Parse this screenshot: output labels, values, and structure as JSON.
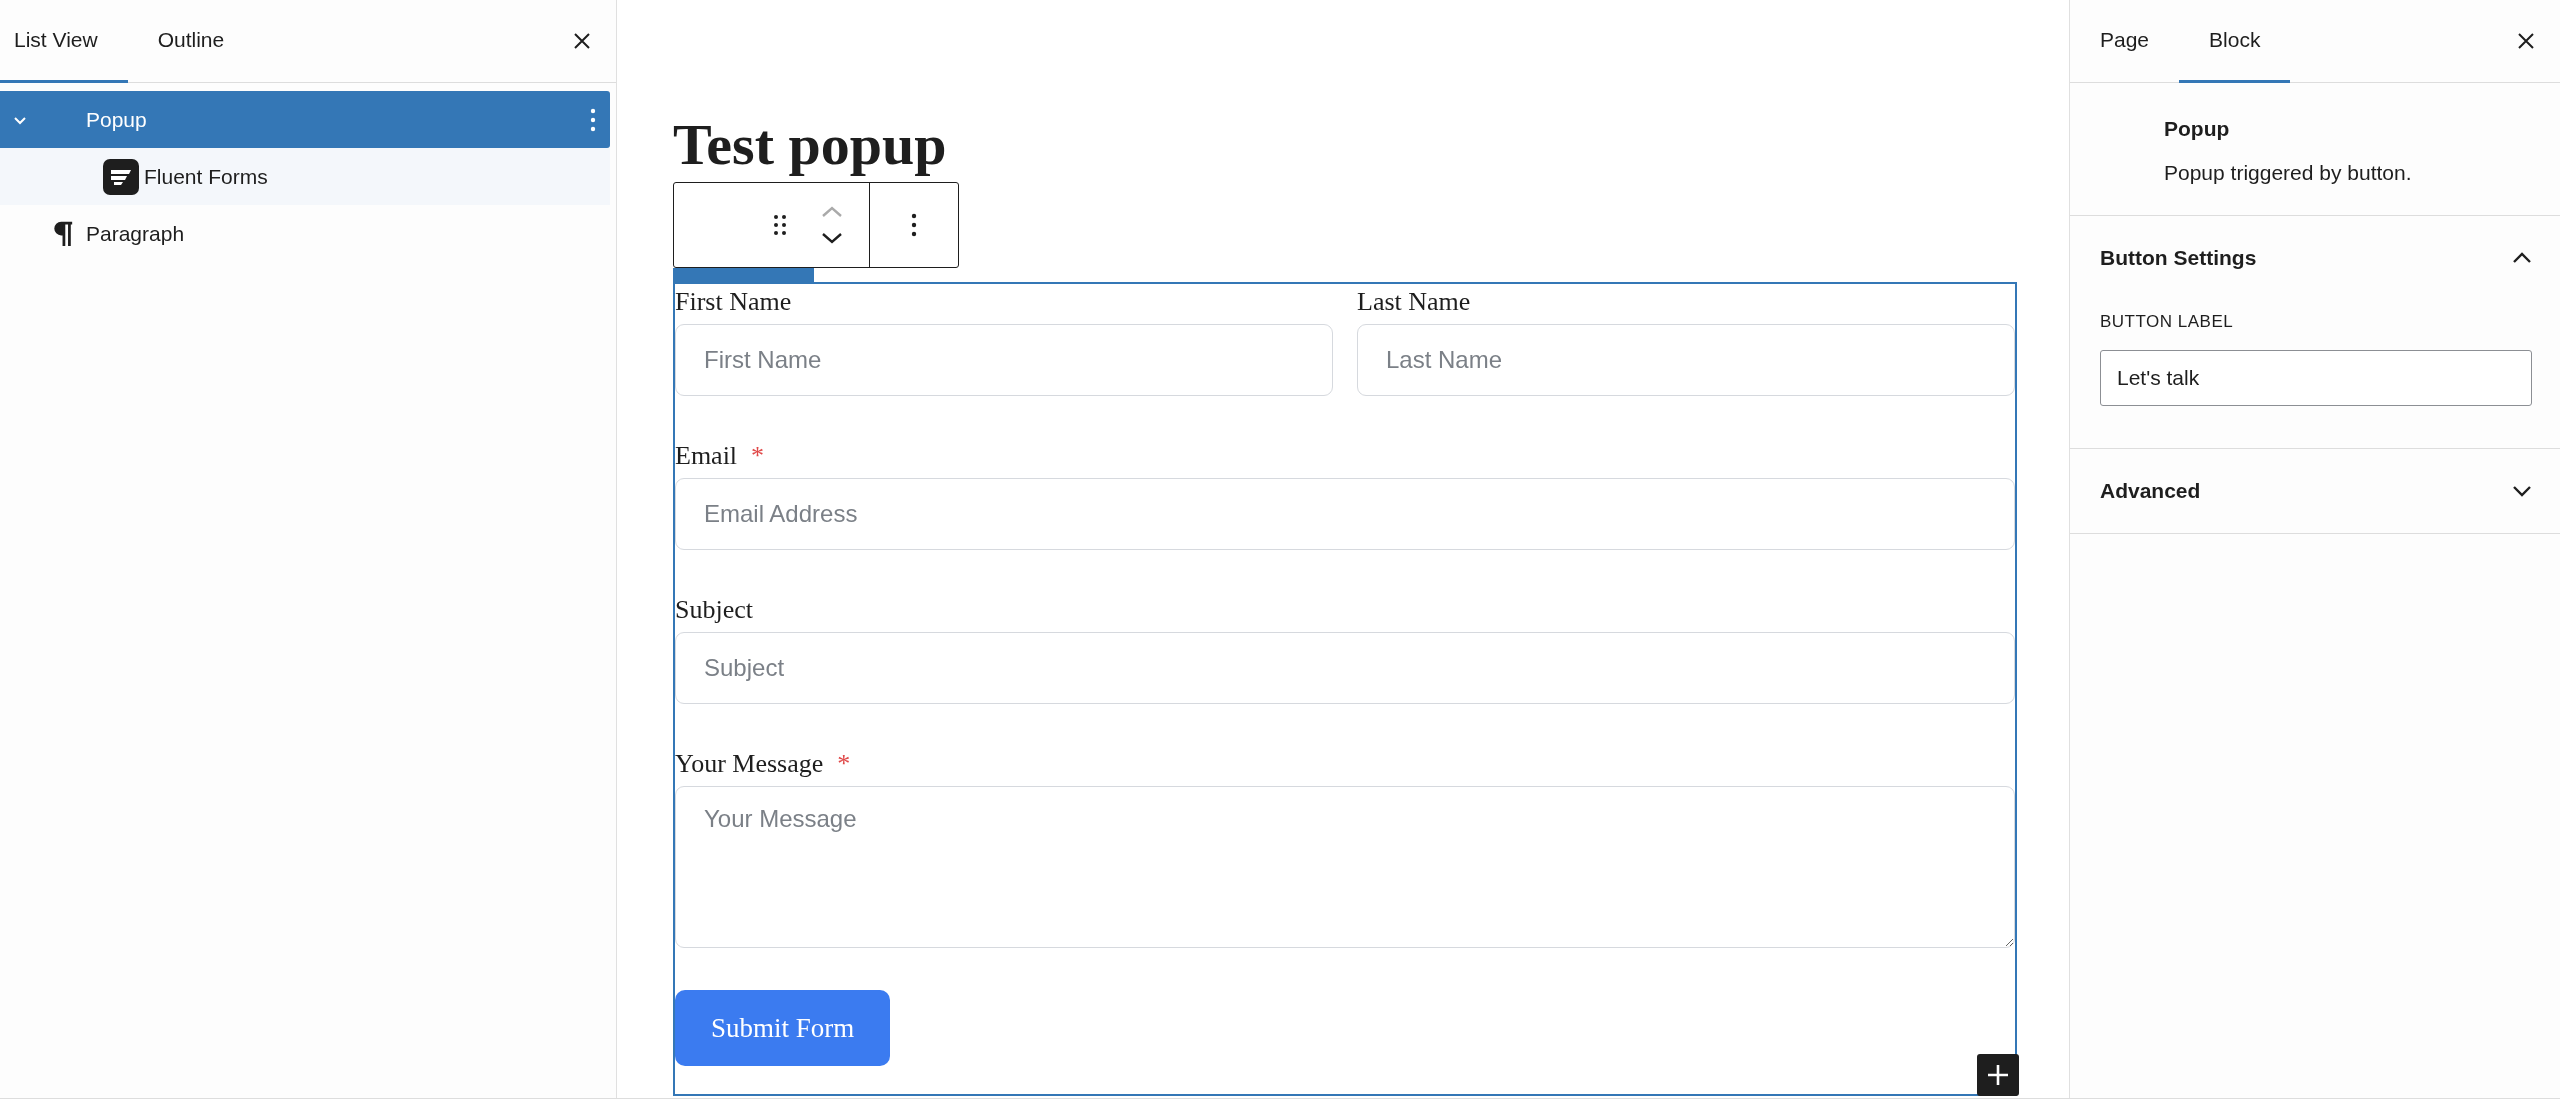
{
  "list_panel": {
    "tabs": [
      {
        "label": "List View",
        "selected": true
      },
      {
        "label": "Outline",
        "selected": false
      }
    ],
    "tree": [
      {
        "label": "Popup",
        "kind": "group",
        "selected": true,
        "expanded": true,
        "children": [
          {
            "label": "Fluent Forms",
            "kind": "form",
            "selected": false
          }
        ]
      },
      {
        "label": "Paragraph",
        "kind": "paragraph",
        "selected": false
      }
    ]
  },
  "editor": {
    "title": "Test popup",
    "form_rows": [
      {
        "fields": [
          {
            "label": "First Name",
            "placeholder": "First Name",
            "kind": "input"
          },
          {
            "label": "Last Name",
            "placeholder": "Last Name",
            "kind": "input"
          }
        ]
      },
      {
        "fields": [
          {
            "label": "Email",
            "required_mark": "*",
            "placeholder": "Email Address",
            "kind": "input"
          }
        ]
      },
      {
        "fields": [
          {
            "label": "Subject",
            "placeholder": "Subject",
            "kind": "input"
          }
        ]
      },
      {
        "fields": [
          {
            "label": "Your Message",
            "required_mark": "*",
            "placeholder": "Your Message",
            "kind": "textarea"
          }
        ]
      }
    ],
    "submit": "Submit Form"
  },
  "settings_panel": {
    "tabs": [
      {
        "label": "Page",
        "selected": false
      },
      {
        "label": "Block",
        "selected": true
      }
    ],
    "block": {
      "title": "Popup",
      "description": "Popup triggered by button."
    },
    "sections": [
      {
        "title": "Button Settings",
        "expanded": true,
        "fields": [
          {
            "label": "BUTTON LABEL",
            "value": "Let's talk"
          }
        ]
      },
      {
        "title": "Advanced",
        "expanded": false
      }
    ]
  }
}
